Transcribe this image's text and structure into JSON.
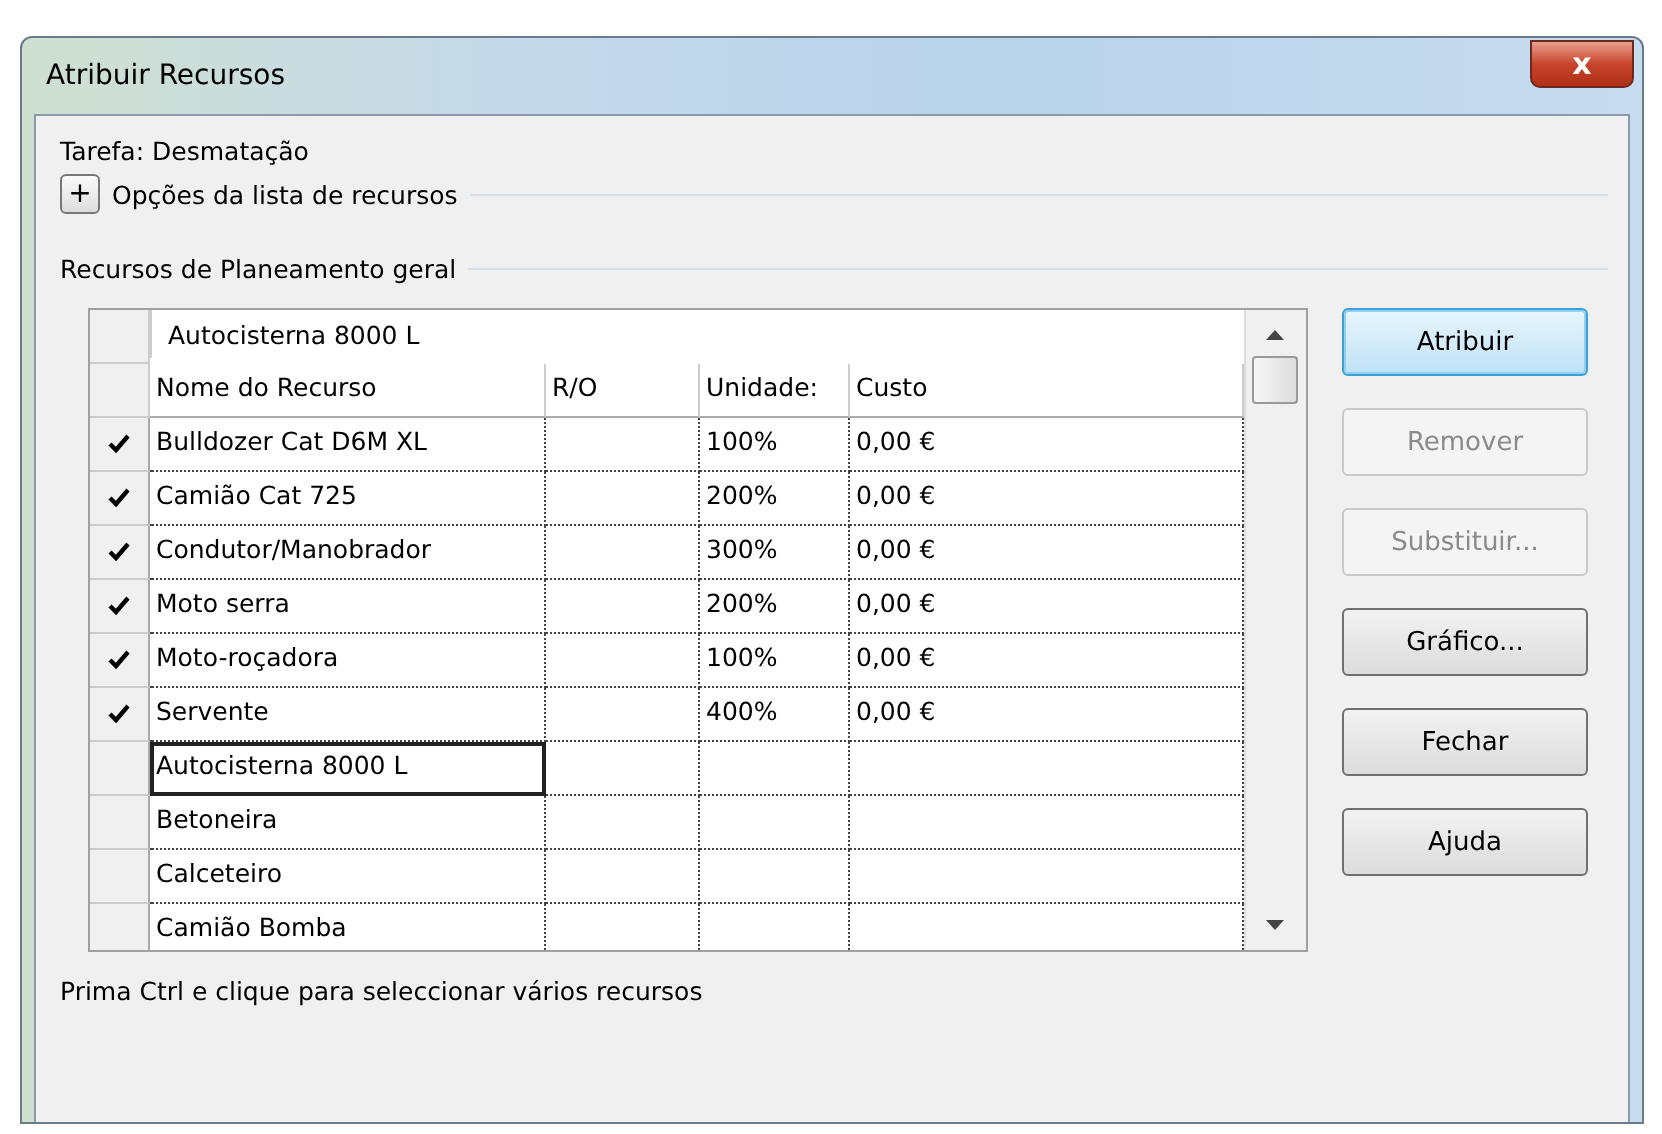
{
  "window": {
    "title": "Atribuir Recursos",
    "close": "x"
  },
  "task_label": "Tarefa: Desmatação",
  "options_toggle": {
    "symbol": "+",
    "label": "Opções da lista de recursos",
    "expanded": false
  },
  "group_label": "Recursos de Planeamento geral",
  "table": {
    "edit_value": "Autocisterna 8000 L",
    "columns": [
      "Nome do Recurso",
      "R/O",
      "Unidade:",
      "Custo"
    ],
    "rows": [
      {
        "checked": true,
        "selected": false,
        "cells": [
          "Bulldozer Cat D6M XL",
          "",
          "100%",
          "0,00 €"
        ]
      },
      {
        "checked": true,
        "selected": false,
        "cells": [
          "Camião Cat 725",
          "",
          "200%",
          "0,00 €"
        ]
      },
      {
        "checked": true,
        "selected": false,
        "cells": [
          "Condutor/Manobrador",
          "",
          "300%",
          "0,00 €"
        ]
      },
      {
        "checked": true,
        "selected": false,
        "cells": [
          "Moto serra",
          "",
          "200%",
          "0,00 €"
        ]
      },
      {
        "checked": true,
        "selected": false,
        "cells": [
          "Moto-roçadora",
          "",
          "100%",
          "0,00 €"
        ]
      },
      {
        "checked": true,
        "selected": false,
        "cells": [
          "Servente",
          "",
          "400%",
          "0,00 €"
        ]
      },
      {
        "checked": false,
        "selected": true,
        "cells": [
          "Autocisterna 8000 L",
          "",
          "",
          ""
        ]
      },
      {
        "checked": false,
        "selected": false,
        "cells": [
          "Betoneira",
          "",
          "",
          ""
        ]
      },
      {
        "checked": false,
        "selected": false,
        "cells": [
          "Calceteiro",
          "",
          "",
          ""
        ]
      },
      {
        "checked": false,
        "selected": false,
        "cells": [
          "Camião Bomba",
          "",
          "",
          ""
        ]
      }
    ]
  },
  "buttons": [
    {
      "label": "Atribuir",
      "disabled": false,
      "default": true
    },
    {
      "label": "Remover",
      "disabled": true,
      "default": false
    },
    {
      "label": "Substituir...",
      "disabled": true,
      "default": false
    },
    {
      "label": "Gráfico...",
      "disabled": false,
      "default": false
    },
    {
      "label": "Fechar",
      "disabled": false,
      "default": false
    },
    {
      "label": "Ajuda",
      "disabled": false,
      "default": false
    }
  ],
  "hint": "Prima Ctrl e clique para seleccionar vários recursos"
}
